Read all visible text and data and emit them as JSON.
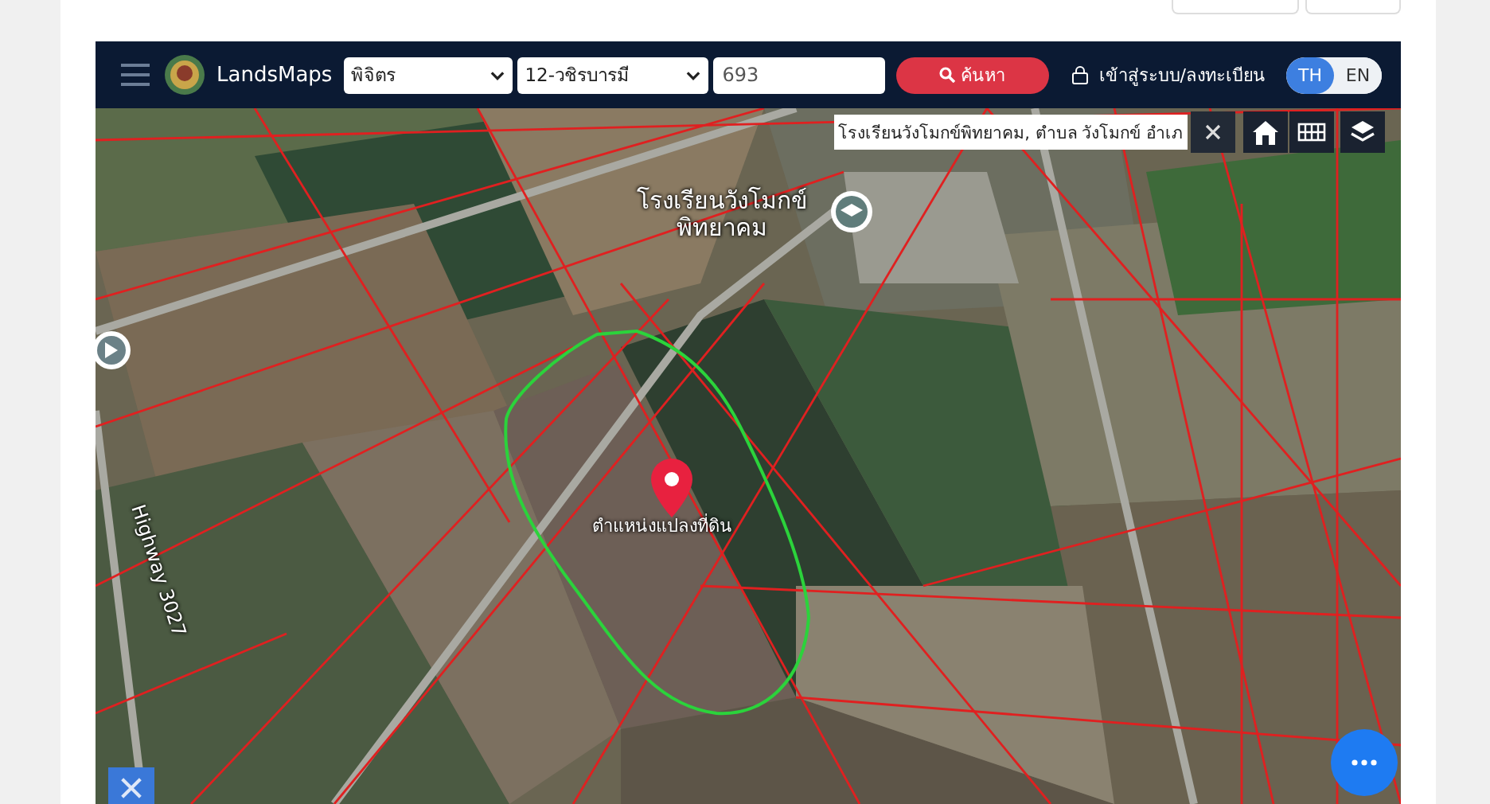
{
  "header": {
    "brand": "LandsMaps",
    "province": {
      "value": "พิจิตร"
    },
    "district": {
      "value": "12-วชิรบารมี"
    },
    "parcel": {
      "value": "693"
    },
    "search_button": "ค้นหา",
    "login": "เข้าสู่ระบบ/ลงทะเบียน",
    "languages": [
      {
        "label": "TH",
        "selected": true
      },
      {
        "label": "EN",
        "selected": false
      }
    ]
  },
  "map": {
    "search_result": "โรงเรียนวังโมกข์พิทยาคม, ตำบล วังโมกข์ อำเภ",
    "labels": [
      {
        "kind": "place",
        "lines": [
          "โรงเรียนวังโมกข์",
          "พิทยาคม"
        ]
      },
      {
        "kind": "pin",
        "lines": [
          "ตำแหน่งแปลงที่ดิน"
        ]
      },
      {
        "kind": "road",
        "lines": [
          "Highway 3027"
        ]
      }
    ]
  }
}
